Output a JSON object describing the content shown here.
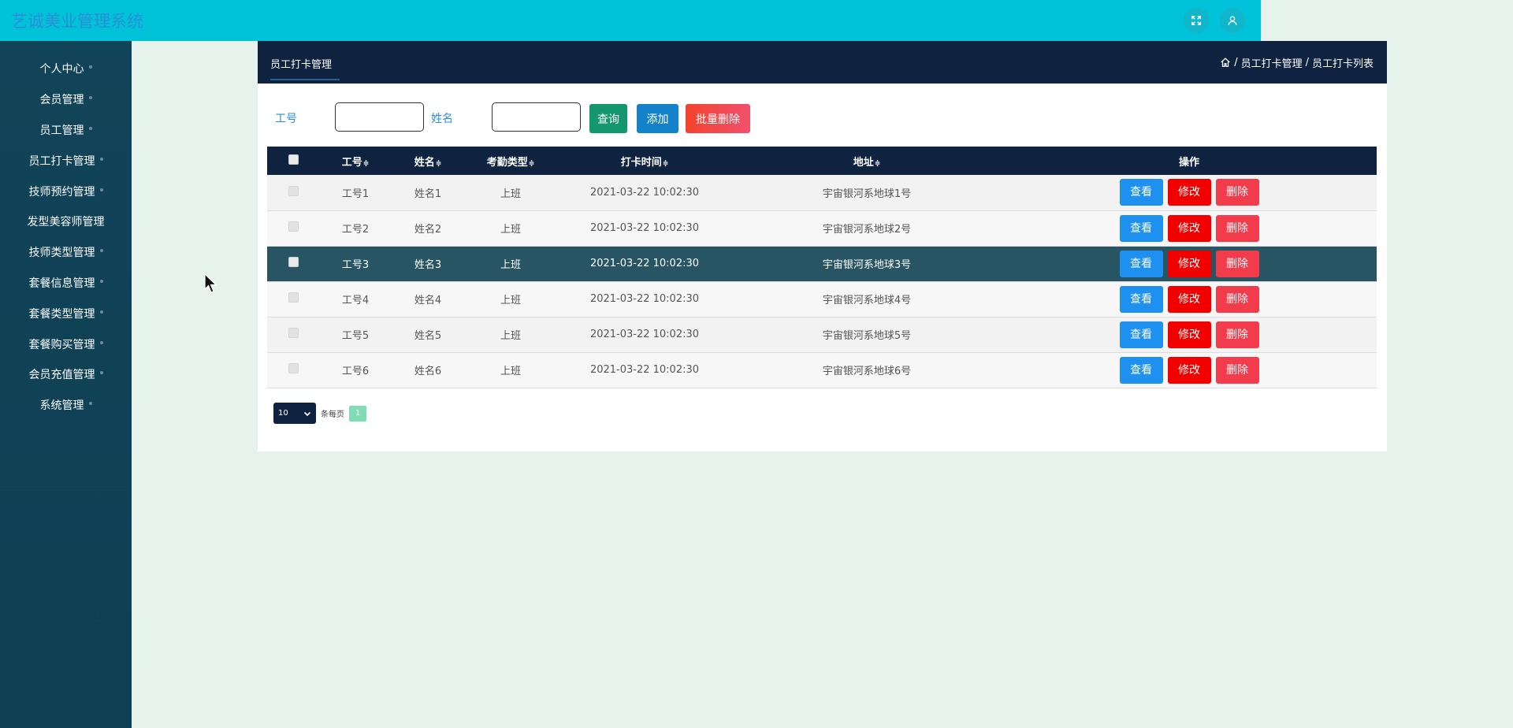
{
  "app": {
    "title": "艺诚美业管理系统"
  },
  "header": {
    "icons": [
      "fullscreen-icon",
      "user-icon"
    ]
  },
  "sidebar": {
    "items": [
      {
        "label": "个人中心"
      },
      {
        "label": "会员管理"
      },
      {
        "label": "员工管理"
      },
      {
        "label": "员工打卡管理"
      },
      {
        "label": "技师预约管理"
      },
      {
        "label": "发型美容师管理"
      },
      {
        "label": "技师类型管理"
      },
      {
        "label": "套餐信息管理"
      },
      {
        "label": "套餐类型管理"
      },
      {
        "label": "套餐购买管理"
      },
      {
        "label": "会员充值管理"
      },
      {
        "label": "系统管理"
      }
    ]
  },
  "panel": {
    "tab": "员工打卡管理",
    "breadcrumb": {
      "sep": "/",
      "level1": "员工打卡管理",
      "level2": "员工打卡列表"
    }
  },
  "search": {
    "id_label": "工号",
    "id_value": "",
    "name_label": "姓名",
    "name_value": "",
    "query_label": "查询",
    "add_label": "添加",
    "batch_delete_label": "批量删除"
  },
  "table": {
    "columns": [
      "工号",
      "姓名",
      "考勤类型",
      "打卡时间",
      "地址",
      "操作"
    ],
    "sortable": "≑",
    "actions": {
      "view": "查看",
      "edit": "修改",
      "delete": "删除"
    },
    "rows": [
      {
        "id": "工号1",
        "name": "姓名1",
        "type": "上班",
        "time": "2021-03-22 10:02:30",
        "address": "宇宙银河系地球1号"
      },
      {
        "id": "工号2",
        "name": "姓名2",
        "type": "上班",
        "time": "2021-03-22 10:02:30",
        "address": "宇宙银河系地球2号"
      },
      {
        "id": "工号3",
        "name": "姓名3",
        "type": "上班",
        "time": "2021-03-22 10:02:30",
        "address": "宇宙银河系地球3号"
      },
      {
        "id": "工号4",
        "name": "姓名4",
        "type": "上班",
        "time": "2021-03-22 10:02:30",
        "address": "宇宙银河系地球4号"
      },
      {
        "id": "工号5",
        "name": "姓名5",
        "type": "上班",
        "time": "2021-03-22 10:02:30",
        "address": "宇宙银河系地球5号"
      },
      {
        "id": "工号6",
        "name": "姓名6",
        "type": "上班",
        "time": "2021-03-22 10:02:30",
        "address": "宇宙银河系地球6号"
      }
    ]
  },
  "pagination": {
    "page_size": "10",
    "per_page_text": "条每页",
    "current_page": "1"
  },
  "colors": {
    "topbar": "#00c2d8",
    "sidebar": "#124459",
    "panel_header": "#0f2341",
    "active_row": "#275563",
    "view": "#1e90f0",
    "edit": "#f20000",
    "delete": "#f23c4c"
  }
}
